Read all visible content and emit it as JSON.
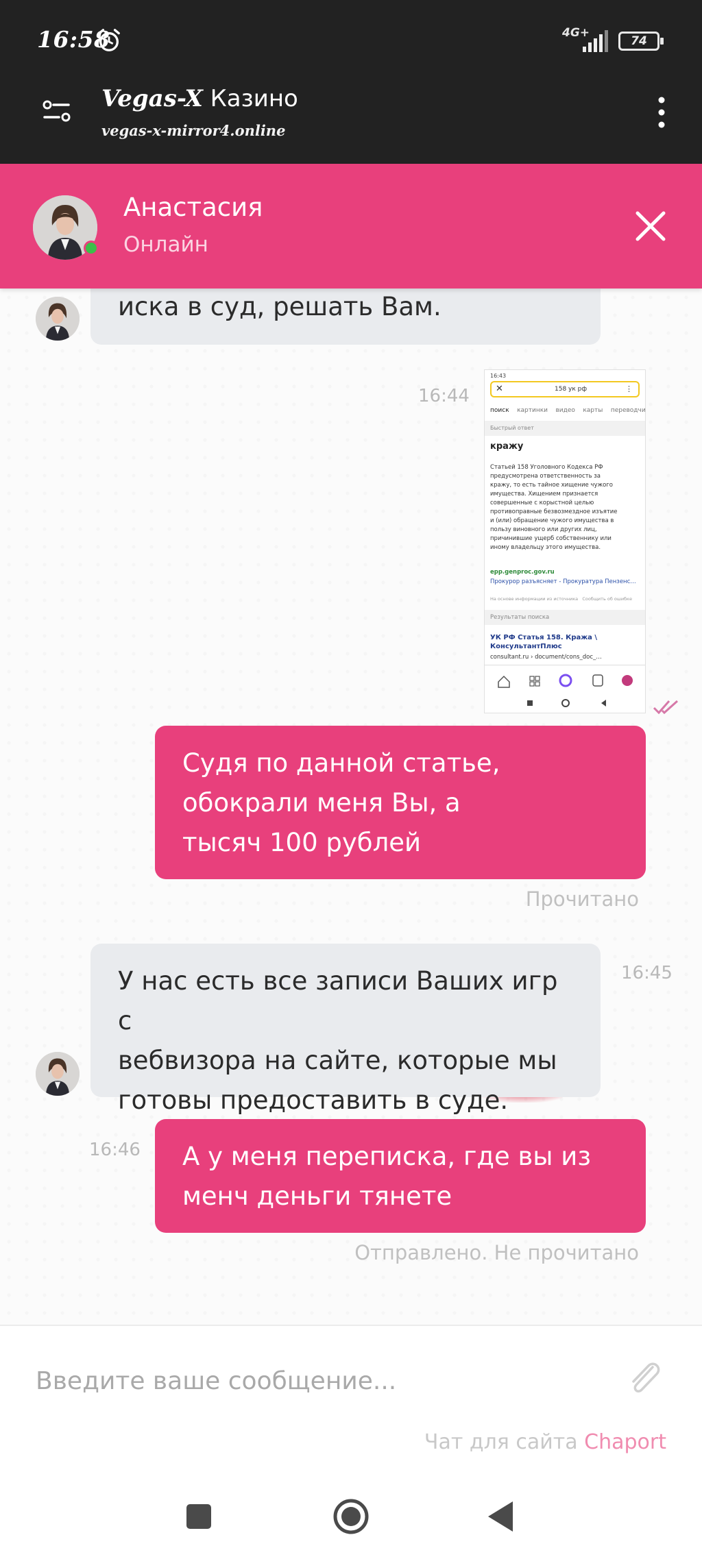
{
  "status_bar": {
    "time": "16:58",
    "network": "4G+",
    "battery": "74",
    "icons": [
      "alarm-icon",
      "signal-icon",
      "battery-icon"
    ]
  },
  "browser": {
    "site_brand": "Vegas-X",
    "site_title_rest": " Казино",
    "url": "vegas-x-mirror4.online",
    "icons": [
      "site-settings-icon",
      "menu-icon"
    ]
  },
  "chat_header": {
    "agent_name": "Анастасия",
    "agent_status": "Онлайн",
    "accent_color": "#e8407c"
  },
  "messages": [
    {
      "direction": "incoming",
      "lines": [
        "иска в суд, решать Вам."
      ]
    },
    {
      "direction": "outgoing",
      "type": "image",
      "time": "16:44",
      "thumbnail": {
        "time": "16:43",
        "search_query": "158 ук рф",
        "tabs": [
          "поиск",
          "картинки",
          "видео",
          "карты",
          "переводчик"
        ],
        "quick_answer": "Быстрый ответ",
        "answer_title": "кражу",
        "answer_lines": [
          "Статьей 158 Уголовного Кодекса РФ",
          "предусмотрена ответственность за",
          "кражу, то есть тайное хищение чужого",
          "имущества. Хищением признается",
          "совершенные с корыстной целью",
          "противоправные безвозмездное изъятие",
          "и (или) обращение чужого имущества в",
          "пользу виновного или других лиц,",
          "причинившие ущерб собственнику или",
          "иному владельцу этого имущества."
        ],
        "source_domain": "epp.genproc.gov.ru",
        "source_title": "Прокурор разъясняет - Прокуратура Пензенс…",
        "source_note": "На основе информации из источника",
        "report_link": "Сообщить об ошибке",
        "results_header": "Результаты поиска",
        "result_title_1": "УК РФ Статья 158. Кража \\",
        "result_title_2": "КонсультантПлюс",
        "result_url": "consultant.ru › document/cons_doc_…"
      }
    },
    {
      "direction": "outgoing",
      "lines": [
        "Судя по данной статье,",
        "обокрали меня Вы, а",
        "тысяч 100 рублей"
      ],
      "status": "Прочитано"
    },
    {
      "direction": "incoming",
      "time": "16:45",
      "lines": [
        "У нас есть все записи Ваших игр с",
        "вебвизора на сайте, которые мы",
        "готовы предоставить в суде."
      ]
    },
    {
      "direction": "outgoing",
      "time": "16:46",
      "lines": [
        "А у меня переписка, где вы из",
        "менч деньги тянете"
      ],
      "status": "Отправлено. Не прочитано"
    }
  ],
  "composer": {
    "placeholder": "Введите ваше сообщение...",
    "powered_by": "Чат для сайта ",
    "powered_brand": "Chaport"
  }
}
